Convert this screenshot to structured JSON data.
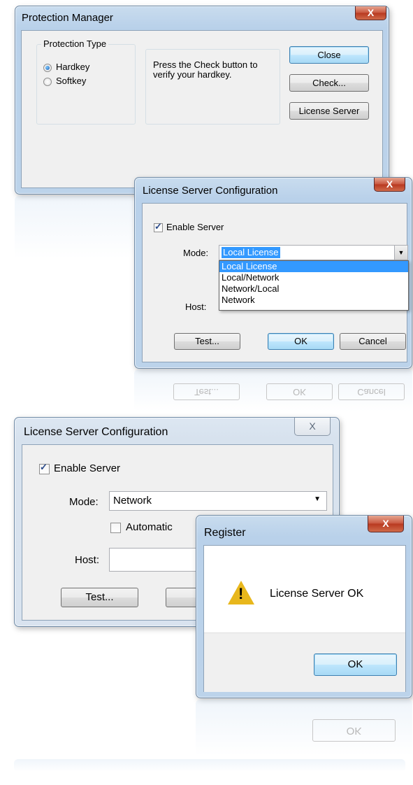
{
  "protection_manager": {
    "title": "Protection Manager",
    "close_glyph": "X",
    "group_label": "Protection Type",
    "options": [
      {
        "label": "Hardkey",
        "selected": true
      },
      {
        "label": "Softkey",
        "selected": false
      }
    ],
    "message": "Press the Check button to verify your hardkey.",
    "buttons": {
      "close": "Close",
      "check": "Check...",
      "license_server": "License Server"
    }
  },
  "license_config_dropdown": {
    "title": "License Server Configuration",
    "close_glyph": "X",
    "enable_label": "Enable Server",
    "enable_checked": true,
    "mode_label": "Mode:",
    "mode_value": "Local License",
    "mode_options": [
      "Local License",
      "Local/Network",
      "Network/Local",
      "Network"
    ],
    "host_label": "Host:",
    "buttons": {
      "test": "Test...",
      "ok": "OK",
      "cancel": "Cancel"
    }
  },
  "license_config_network": {
    "title": "License Server Configuration",
    "close_glyph": "X",
    "enable_label": "Enable Server",
    "enable_checked": true,
    "mode_label": "Mode:",
    "mode_value": "Network",
    "automatic_label": "Automatic",
    "automatic_checked": false,
    "host_label": "Host:",
    "buttons": {
      "test": "Test..."
    }
  },
  "register": {
    "title": "Register",
    "close_glyph": "X",
    "message": "License Server OK",
    "ok": "OK"
  },
  "reflections": {
    "test": "Test...",
    "ok": "OK",
    "cancel": "Cancel",
    "register_ok": "OK"
  },
  "colors": {
    "accent": "#3c7fb1",
    "selection": "#3399ff",
    "title_bar": "#bcd3ea",
    "close_red": "#c8553d"
  }
}
